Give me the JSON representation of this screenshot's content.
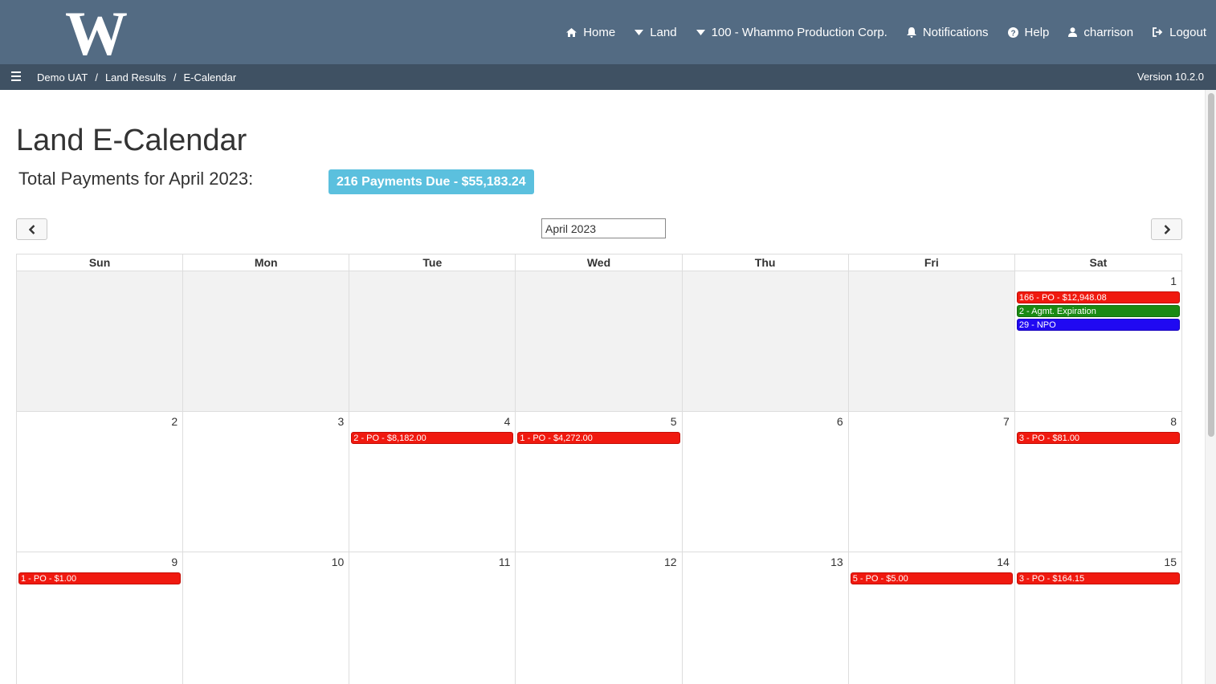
{
  "header": {
    "logo_letter": "W",
    "nav": [
      {
        "label": "Home",
        "icon": "home-icon"
      },
      {
        "label": "Land",
        "icon": "caret-down-icon"
      },
      {
        "label": "100 - Whammo Production Corp.",
        "icon": "caret-down-icon"
      },
      {
        "label": "Notifications",
        "icon": "bell-icon"
      },
      {
        "label": "Help",
        "icon": "question-circle-icon"
      },
      {
        "label": "charrison",
        "icon": "user-icon"
      },
      {
        "label": "Logout",
        "icon": "sign-out-icon"
      }
    ]
  },
  "breadcrumb": {
    "items": [
      "Demo UAT",
      "Land Results",
      "E-Calendar"
    ],
    "separator": "/",
    "version": "Version 10.2.0"
  },
  "page": {
    "title": "Land E-Calendar",
    "total_label": "Total Payments for April 2023:",
    "payments_badge": "216 Payments Due - $55,183.24",
    "month_value": "April 2023"
  },
  "calendar": {
    "weekdays": [
      "Sun",
      "Mon",
      "Tue",
      "Wed",
      "Thu",
      "Fri",
      "Sat"
    ],
    "weeks": [
      [
        {
          "day": "",
          "other": true,
          "events": []
        },
        {
          "day": "",
          "other": true,
          "events": []
        },
        {
          "day": "",
          "other": true,
          "events": []
        },
        {
          "day": "",
          "other": true,
          "events": []
        },
        {
          "day": "",
          "other": true,
          "events": []
        },
        {
          "day": "",
          "other": true,
          "events": []
        },
        {
          "day": "1",
          "events": [
            {
              "label": "166 - PO - $12,948.08",
              "color": "red"
            },
            {
              "label": "2 - Agmt. Expiration",
              "color": "green"
            },
            {
              "label": "29 - NPO",
              "color": "blue"
            }
          ]
        }
      ],
      [
        {
          "day": "2",
          "events": []
        },
        {
          "day": "3",
          "events": []
        },
        {
          "day": "4",
          "events": [
            {
              "label": "2 - PO - $8,182.00",
              "color": "red"
            }
          ]
        },
        {
          "day": "5",
          "events": [
            {
              "label": "1 - PO - $4,272.00",
              "color": "red"
            }
          ]
        },
        {
          "day": "6",
          "events": []
        },
        {
          "day": "7",
          "events": []
        },
        {
          "day": "8",
          "events": [
            {
              "label": "3 - PO - $81.00",
              "color": "red"
            }
          ]
        }
      ],
      [
        {
          "day": "9",
          "events": [
            {
              "label": "1 - PO - $1.00",
              "color": "red"
            }
          ]
        },
        {
          "day": "10",
          "events": []
        },
        {
          "day": "11",
          "events": []
        },
        {
          "day": "12",
          "events": []
        },
        {
          "day": "13",
          "events": []
        },
        {
          "day": "14",
          "events": [
            {
              "label": "5 - PO - $5.00",
              "color": "red"
            }
          ]
        },
        {
          "day": "15",
          "events": [
            {
              "label": "3 - PO - $164.15",
              "color": "red"
            }
          ]
        }
      ]
    ]
  },
  "colors": {
    "topbar": "#536b83",
    "crumbbar": "#3f5163",
    "badge": "#5bc0de",
    "event_red": "#f0190f",
    "event_green": "#1a8a12",
    "event_blue": "#2009f2"
  }
}
